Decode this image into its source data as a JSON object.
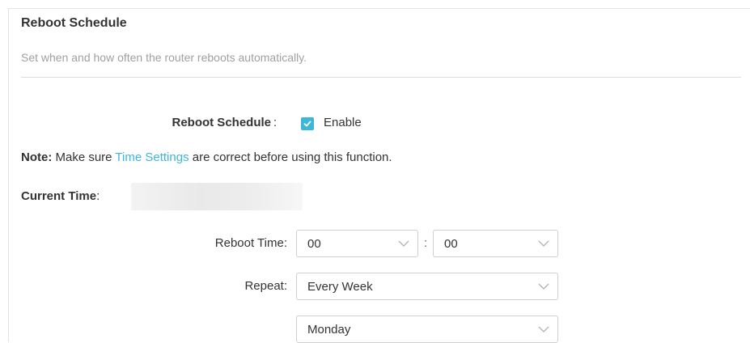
{
  "section": {
    "title": "Reboot Schedule",
    "description": "Set when and how often the router reboots automatically."
  },
  "reboot_schedule": {
    "label": "Reboot Schedule",
    "colon": ":",
    "checkbox_checked": true,
    "checkbox_label": "Enable"
  },
  "note": {
    "prefix": "Note:",
    "text_before": " Make sure ",
    "link": "Time Settings",
    "text_after": " are correct before using this function."
  },
  "current_time": {
    "label": "Current Time",
    "colon": ":"
  },
  "reboot_time": {
    "label": "Reboot Time:",
    "hour": "00",
    "separator": ":",
    "minute": "00"
  },
  "repeat": {
    "label": "Repeat:",
    "value": "Every Week",
    "day": "Monday"
  },
  "colors": {
    "accent": "#3cb7d8",
    "text": "#333333",
    "muted": "#a0a0a0",
    "border": "#cfcfcf"
  },
  "icons": {
    "checkbox": "check-icon",
    "dropdown": "chevron-down-icon"
  }
}
